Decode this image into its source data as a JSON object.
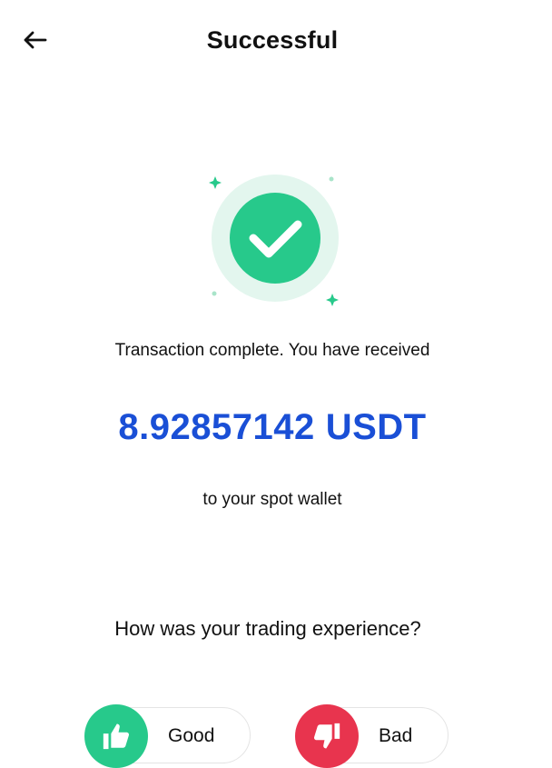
{
  "header": {
    "title": "Successful",
    "back_icon": "arrow-left-icon"
  },
  "status": {
    "icon": "check-circle-icon",
    "color_primary": "#27c98b",
    "color_halo": "#e3f6ee"
  },
  "message": {
    "line1": "Transaction complete. You have received",
    "amount": "8.92857142",
    "currency": "USDT",
    "line2": "to your spot wallet",
    "amount_color": "#1a4fd6"
  },
  "feedback": {
    "question": "How was your trading experience?",
    "good": {
      "label": "Good",
      "icon": "thumbs-up-icon",
      "color": "#27c98b"
    },
    "bad": {
      "label": "Bad",
      "icon": "thumbs-down-icon",
      "color": "#e8344e"
    }
  }
}
